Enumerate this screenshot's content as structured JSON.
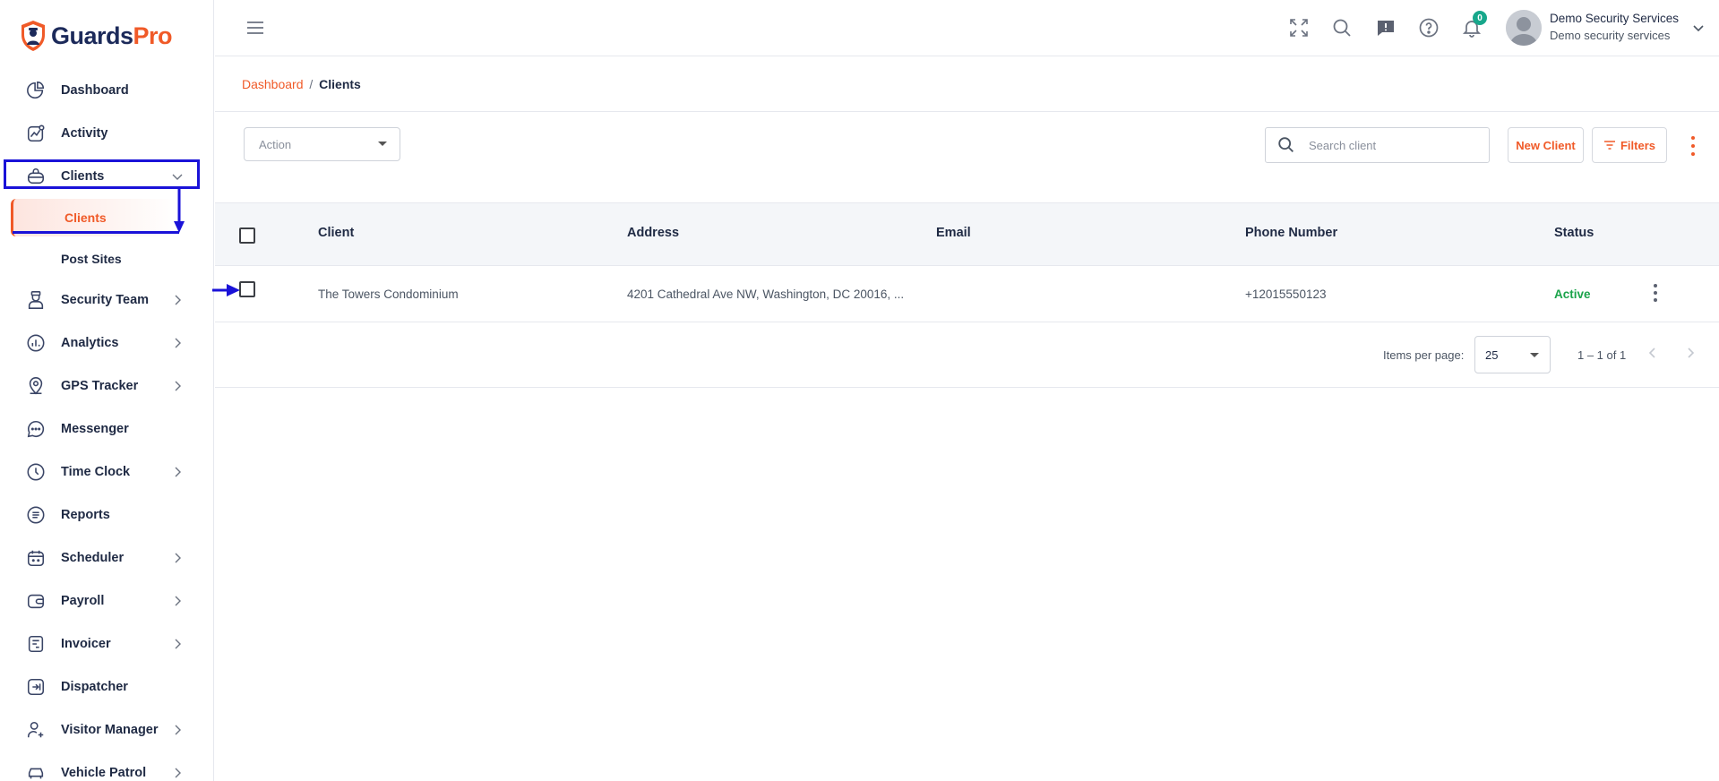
{
  "brand": {
    "name_part1": "Guards",
    "name_part2": "Pro",
    "primary_color": "#1c2a5a",
    "accent_color": "#f05a28"
  },
  "sidebar": {
    "items": [
      {
        "label": "Dashboard",
        "icon": "dashboard-icon"
      },
      {
        "label": "Activity",
        "icon": "activity-icon"
      },
      {
        "label": "Clients",
        "icon": "briefcase-icon",
        "expanded": true,
        "children": [
          {
            "label": "Clients",
            "active": true
          },
          {
            "label": "Post Sites"
          }
        ]
      },
      {
        "label": "Security Team",
        "icon": "guard-icon",
        "has_children": true
      },
      {
        "label": "Analytics",
        "icon": "analytics-icon",
        "has_children": true
      },
      {
        "label": "GPS Tracker",
        "icon": "map-pin-icon",
        "has_children": true
      },
      {
        "label": "Messenger",
        "icon": "chat-icon"
      },
      {
        "label": "Time Clock",
        "icon": "clock-icon",
        "has_children": true
      },
      {
        "label": "Reports",
        "icon": "reports-icon"
      },
      {
        "label": "Scheduler",
        "icon": "calendar-icon",
        "has_children": true
      },
      {
        "label": "Payroll",
        "icon": "wallet-icon",
        "has_children": true
      },
      {
        "label": "Invoicer",
        "icon": "invoice-icon",
        "has_children": true
      },
      {
        "label": "Dispatcher",
        "icon": "dispatch-icon"
      },
      {
        "label": "Visitor Manager",
        "icon": "visitor-icon",
        "has_children": true
      },
      {
        "label": "Vehicle Patrol",
        "icon": "car-icon",
        "has_children": true
      }
    ]
  },
  "header": {
    "notifications_count": "0",
    "user_name": "Demo Security Services",
    "user_company": "Demo security services"
  },
  "breadcrumb": {
    "parent": "Dashboard",
    "separator": "/",
    "current": "Clients"
  },
  "toolbar": {
    "action_placeholder": "Action",
    "search_placeholder": "Search client",
    "new_client_label": "New Client",
    "filters_label": "Filters"
  },
  "table": {
    "columns": [
      "Client",
      "Address",
      "Email",
      "Phone Number",
      "Status"
    ],
    "rows": [
      {
        "client": "The Towers Condominium",
        "address": "4201 Cathedral Ave NW, Washington, DC 20016, ...",
        "email": "",
        "phone": "+12015550123",
        "status": "Active"
      }
    ]
  },
  "paginator": {
    "items_per_page_label": "Items per page:",
    "items_per_page": "25",
    "range": "1 – 1 of 1"
  },
  "annotation_color": "#1a12d8"
}
